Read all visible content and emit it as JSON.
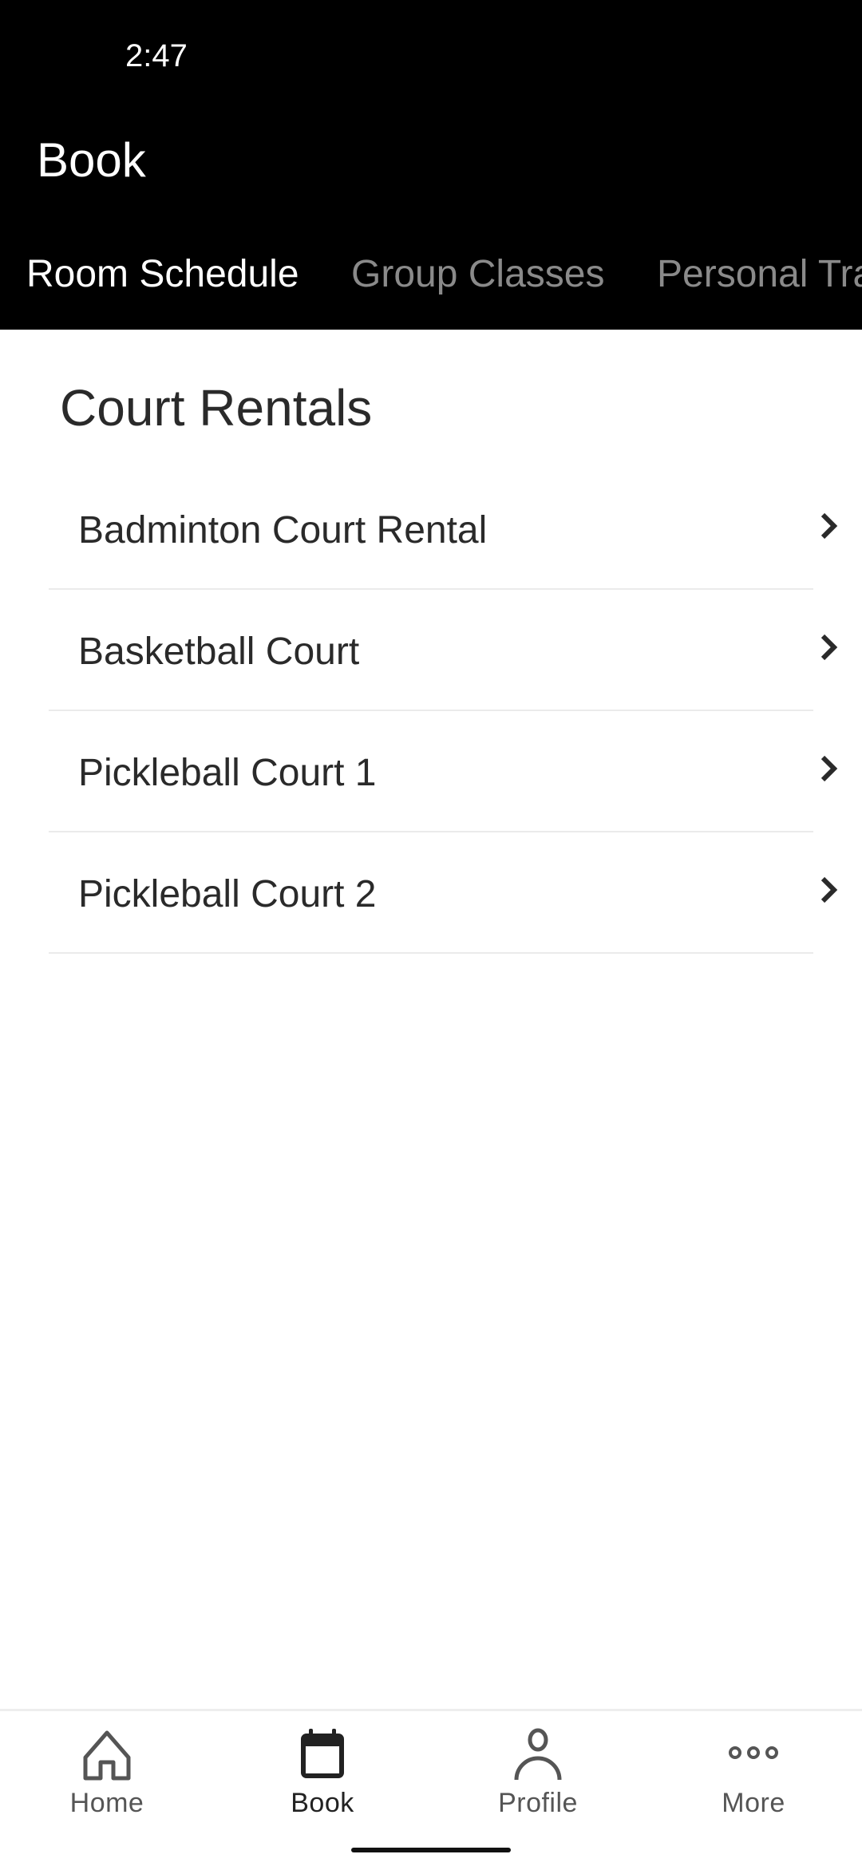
{
  "status_bar": {
    "time": "2:47"
  },
  "header": {
    "title": "Book"
  },
  "tabs": [
    {
      "label": "Room Schedule",
      "active": true
    },
    {
      "label": "Group Classes",
      "active": false
    },
    {
      "label": "Personal Training",
      "active": false
    }
  ],
  "section": {
    "title": "Court Rentals",
    "items": [
      {
        "label": "Badminton Court Rental",
        "icon": "chevron-right-icon"
      },
      {
        "label": "Basketball Court",
        "icon": "chevron-right-icon"
      },
      {
        "label": "Pickleball Court 1",
        "icon": "chevron-right-icon"
      },
      {
        "label": "Pickleball Court 2",
        "icon": "chevron-right-icon"
      }
    ]
  },
  "bottom_nav": {
    "items": [
      {
        "label": "Home",
        "icon": "home-icon"
      },
      {
        "label": "Book",
        "icon": "calendar-icon",
        "active": true
      },
      {
        "label": "Profile",
        "icon": "person-icon"
      },
      {
        "label": "More",
        "icon": "more-dots-icon"
      }
    ]
  },
  "colors": {
    "header_bg": "#000000",
    "active_tab": "#ffffff",
    "inactive_tab": "#8a8a8a",
    "text": "#2a2a2a"
  }
}
